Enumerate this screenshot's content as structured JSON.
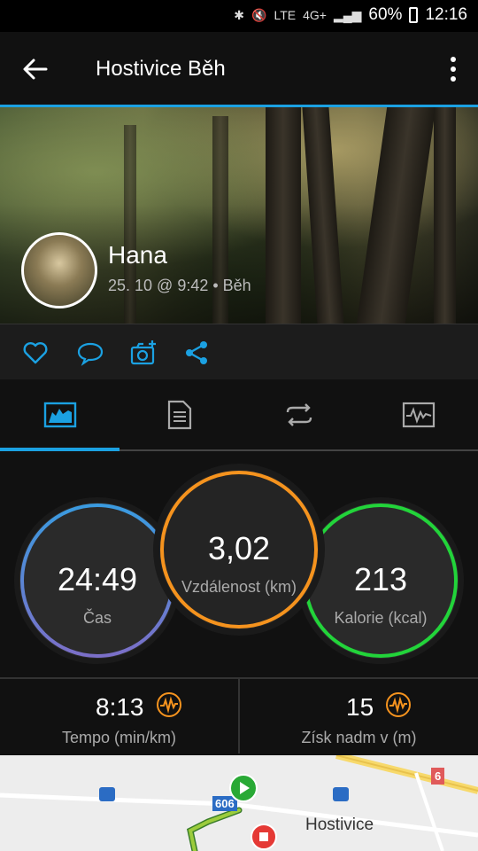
{
  "status": {
    "battery": "60%",
    "time": "12:16",
    "network": "4G+"
  },
  "appbar": {
    "title": "Hostivice Běh"
  },
  "profile": {
    "name": "Hana",
    "meta": "25. 10 @ 9:42 • Běh"
  },
  "stats": {
    "time": {
      "value": "24:49",
      "label": "Čas"
    },
    "distance": {
      "value": "3,02",
      "label": "Vzdálenost (km)"
    },
    "calories": {
      "value": "213",
      "label": "Kalorie (kcal)"
    }
  },
  "bottom": {
    "pace": {
      "value": "8:13",
      "label": "Tempo (min/km)"
    },
    "elevation": {
      "value": "15",
      "label": "Získ nadm v (m)"
    }
  },
  "map": {
    "place": "Hostivice",
    "road_606": "606",
    "road_6": "6"
  },
  "colors": {
    "accent": "#1ba1e2",
    "time_ring": "#4a90e2",
    "distance_ring": "#f5931e",
    "calories_ring": "#2ecc40"
  }
}
